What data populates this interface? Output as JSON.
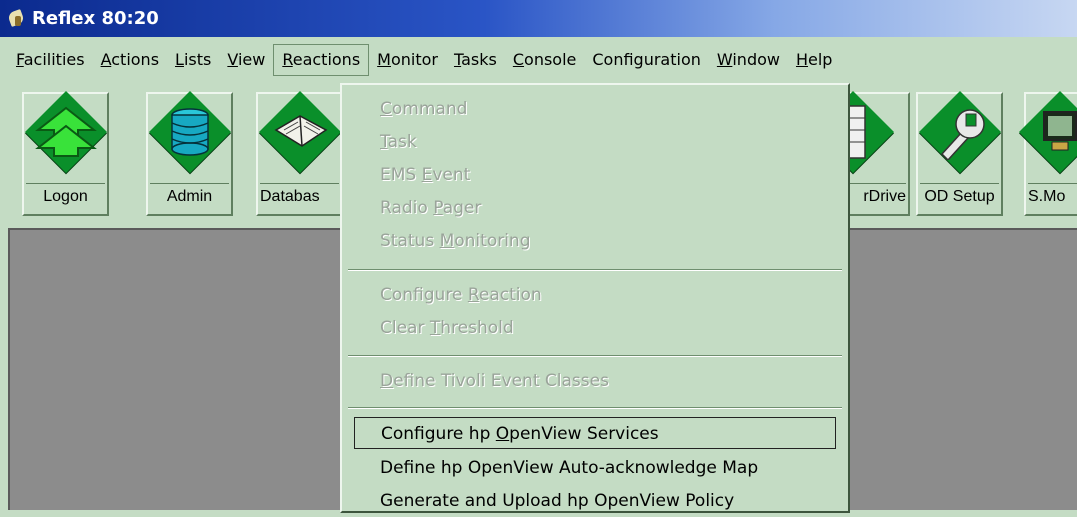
{
  "window": {
    "title": "Reflex 80:20"
  },
  "menubar": {
    "items": [
      {
        "label": "Facilities",
        "u": "F",
        "rest": "acilities"
      },
      {
        "label": "Actions",
        "u": "A",
        "rest": "ctions"
      },
      {
        "label": "Lists",
        "u": "L",
        "rest": "ists"
      },
      {
        "label": "View",
        "u": "V",
        "rest": "iew"
      },
      {
        "label": "Reactions",
        "u": "R",
        "rest": "eactions"
      },
      {
        "label": "Monitor",
        "u": "M",
        "rest": "onitor"
      },
      {
        "label": "Tasks",
        "u": "T",
        "rest": "asks"
      },
      {
        "label": "Console",
        "u": "C",
        "rest": "onsole"
      },
      {
        "label": "Configuration",
        "u": "",
        "rest": "Configuration"
      },
      {
        "label": "Window",
        "u": "W",
        "rest": "indow"
      },
      {
        "label": "Help",
        "u": "H",
        "rest": "elp"
      }
    ]
  },
  "toolbar": {
    "buttons": [
      {
        "label": "Logon",
        "icon": "green-arrow-up-icon"
      },
      {
        "label": "Admin",
        "icon": "database-stack-icon"
      },
      {
        "label": "Databas",
        "icon": "book-icon"
      },
      {
        "label": "rDrive",
        "icon": "server-tower-icon"
      },
      {
        "label": "OD Setup",
        "icon": "wrench-icon"
      },
      {
        "label": "S.Mo",
        "icon": "monitor-icon"
      }
    ]
  },
  "dropdown": {
    "items": [
      {
        "pre": "",
        "u": "C",
        "post": "ommand",
        "disabled": true
      },
      {
        "pre": "",
        "u": "T",
        "post": "ask",
        "disabled": true
      },
      {
        "pre": "EMS ",
        "u": "E",
        "post": "vent",
        "disabled": true
      },
      {
        "pre": "Radio ",
        "u": "P",
        "post": "ager",
        "disabled": true
      },
      {
        "pre": "Status ",
        "u": "M",
        "post": "onitoring",
        "disabled": true
      },
      {
        "pre": "Configure ",
        "u": "R",
        "post": "eaction",
        "disabled": true
      },
      {
        "pre": "Clear ",
        "u": "T",
        "post": "hreshold",
        "disabled": true
      },
      {
        "pre": "",
        "u": "D",
        "post": "efine Tivoli Event Classes",
        "disabled": true
      },
      {
        "pre": "Configure hp ",
        "u": "O",
        "post": "penView Services",
        "disabled": false,
        "selected": true
      },
      {
        "pre": "Define hp OpenView Auto-acknowledge Map",
        "u": "",
        "post": "",
        "disabled": false
      },
      {
        "pre": "Generate and Upload hp OpenView Policy",
        "u": "",
        "post": "",
        "disabled": false
      }
    ]
  }
}
